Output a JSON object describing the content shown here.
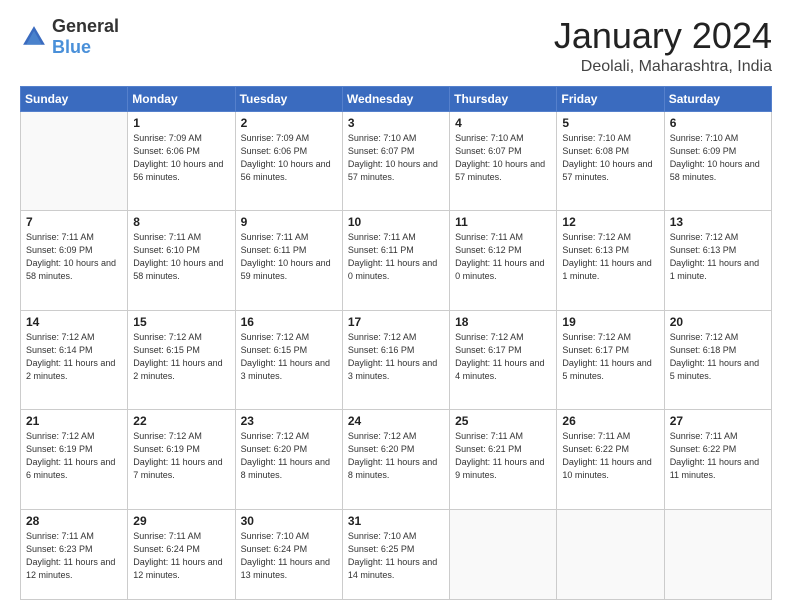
{
  "header": {
    "logo_general": "General",
    "logo_blue": "Blue",
    "month_year": "January 2024",
    "location": "Deolali, Maharashtra, India"
  },
  "weekdays": [
    "Sunday",
    "Monday",
    "Tuesday",
    "Wednesday",
    "Thursday",
    "Friday",
    "Saturday"
  ],
  "weeks": [
    [
      {
        "day": "",
        "sunrise": "",
        "sunset": "",
        "daylight": ""
      },
      {
        "day": "1",
        "sunrise": "Sunrise: 7:09 AM",
        "sunset": "Sunset: 6:06 PM",
        "daylight": "Daylight: 10 hours and 56 minutes."
      },
      {
        "day": "2",
        "sunrise": "Sunrise: 7:09 AM",
        "sunset": "Sunset: 6:06 PM",
        "daylight": "Daylight: 10 hours and 56 minutes."
      },
      {
        "day": "3",
        "sunrise": "Sunrise: 7:10 AM",
        "sunset": "Sunset: 6:07 PM",
        "daylight": "Daylight: 10 hours and 57 minutes."
      },
      {
        "day": "4",
        "sunrise": "Sunrise: 7:10 AM",
        "sunset": "Sunset: 6:07 PM",
        "daylight": "Daylight: 10 hours and 57 minutes."
      },
      {
        "day": "5",
        "sunrise": "Sunrise: 7:10 AM",
        "sunset": "Sunset: 6:08 PM",
        "daylight": "Daylight: 10 hours and 57 minutes."
      },
      {
        "day": "6",
        "sunrise": "Sunrise: 7:10 AM",
        "sunset": "Sunset: 6:09 PM",
        "daylight": "Daylight: 10 hours and 58 minutes."
      }
    ],
    [
      {
        "day": "7",
        "sunrise": "Sunrise: 7:11 AM",
        "sunset": "Sunset: 6:09 PM",
        "daylight": "Daylight: 10 hours and 58 minutes."
      },
      {
        "day": "8",
        "sunrise": "Sunrise: 7:11 AM",
        "sunset": "Sunset: 6:10 PM",
        "daylight": "Daylight: 10 hours and 58 minutes."
      },
      {
        "day": "9",
        "sunrise": "Sunrise: 7:11 AM",
        "sunset": "Sunset: 6:11 PM",
        "daylight": "Daylight: 10 hours and 59 minutes."
      },
      {
        "day": "10",
        "sunrise": "Sunrise: 7:11 AM",
        "sunset": "Sunset: 6:11 PM",
        "daylight": "Daylight: 11 hours and 0 minutes."
      },
      {
        "day": "11",
        "sunrise": "Sunrise: 7:11 AM",
        "sunset": "Sunset: 6:12 PM",
        "daylight": "Daylight: 11 hours and 0 minutes."
      },
      {
        "day": "12",
        "sunrise": "Sunrise: 7:12 AM",
        "sunset": "Sunset: 6:13 PM",
        "daylight": "Daylight: 11 hours and 1 minute."
      },
      {
        "day": "13",
        "sunrise": "Sunrise: 7:12 AM",
        "sunset": "Sunset: 6:13 PM",
        "daylight": "Daylight: 11 hours and 1 minute."
      }
    ],
    [
      {
        "day": "14",
        "sunrise": "Sunrise: 7:12 AM",
        "sunset": "Sunset: 6:14 PM",
        "daylight": "Daylight: 11 hours and 2 minutes."
      },
      {
        "day": "15",
        "sunrise": "Sunrise: 7:12 AM",
        "sunset": "Sunset: 6:15 PM",
        "daylight": "Daylight: 11 hours and 2 minutes."
      },
      {
        "day": "16",
        "sunrise": "Sunrise: 7:12 AM",
        "sunset": "Sunset: 6:15 PM",
        "daylight": "Daylight: 11 hours and 3 minutes."
      },
      {
        "day": "17",
        "sunrise": "Sunrise: 7:12 AM",
        "sunset": "Sunset: 6:16 PM",
        "daylight": "Daylight: 11 hours and 3 minutes."
      },
      {
        "day": "18",
        "sunrise": "Sunrise: 7:12 AM",
        "sunset": "Sunset: 6:17 PM",
        "daylight": "Daylight: 11 hours and 4 minutes."
      },
      {
        "day": "19",
        "sunrise": "Sunrise: 7:12 AM",
        "sunset": "Sunset: 6:17 PM",
        "daylight": "Daylight: 11 hours and 5 minutes."
      },
      {
        "day": "20",
        "sunrise": "Sunrise: 7:12 AM",
        "sunset": "Sunset: 6:18 PM",
        "daylight": "Daylight: 11 hours and 5 minutes."
      }
    ],
    [
      {
        "day": "21",
        "sunrise": "Sunrise: 7:12 AM",
        "sunset": "Sunset: 6:19 PM",
        "daylight": "Daylight: 11 hours and 6 minutes."
      },
      {
        "day": "22",
        "sunrise": "Sunrise: 7:12 AM",
        "sunset": "Sunset: 6:19 PM",
        "daylight": "Daylight: 11 hours and 7 minutes."
      },
      {
        "day": "23",
        "sunrise": "Sunrise: 7:12 AM",
        "sunset": "Sunset: 6:20 PM",
        "daylight": "Daylight: 11 hours and 8 minutes."
      },
      {
        "day": "24",
        "sunrise": "Sunrise: 7:12 AM",
        "sunset": "Sunset: 6:20 PM",
        "daylight": "Daylight: 11 hours and 8 minutes."
      },
      {
        "day": "25",
        "sunrise": "Sunrise: 7:11 AM",
        "sunset": "Sunset: 6:21 PM",
        "daylight": "Daylight: 11 hours and 9 minutes."
      },
      {
        "day": "26",
        "sunrise": "Sunrise: 7:11 AM",
        "sunset": "Sunset: 6:22 PM",
        "daylight": "Daylight: 11 hours and 10 minutes."
      },
      {
        "day": "27",
        "sunrise": "Sunrise: 7:11 AM",
        "sunset": "Sunset: 6:22 PM",
        "daylight": "Daylight: 11 hours and 11 minutes."
      }
    ],
    [
      {
        "day": "28",
        "sunrise": "Sunrise: 7:11 AM",
        "sunset": "Sunset: 6:23 PM",
        "daylight": "Daylight: 11 hours and 12 minutes."
      },
      {
        "day": "29",
        "sunrise": "Sunrise: 7:11 AM",
        "sunset": "Sunset: 6:24 PM",
        "daylight": "Daylight: 11 hours and 12 minutes."
      },
      {
        "day": "30",
        "sunrise": "Sunrise: 7:10 AM",
        "sunset": "Sunset: 6:24 PM",
        "daylight": "Daylight: 11 hours and 13 minutes."
      },
      {
        "day": "31",
        "sunrise": "Sunrise: 7:10 AM",
        "sunset": "Sunset: 6:25 PM",
        "daylight": "Daylight: 11 hours and 14 minutes."
      },
      {
        "day": "",
        "sunrise": "",
        "sunset": "",
        "daylight": ""
      },
      {
        "day": "",
        "sunrise": "",
        "sunset": "",
        "daylight": ""
      },
      {
        "day": "",
        "sunrise": "",
        "sunset": "",
        "daylight": ""
      }
    ]
  ]
}
